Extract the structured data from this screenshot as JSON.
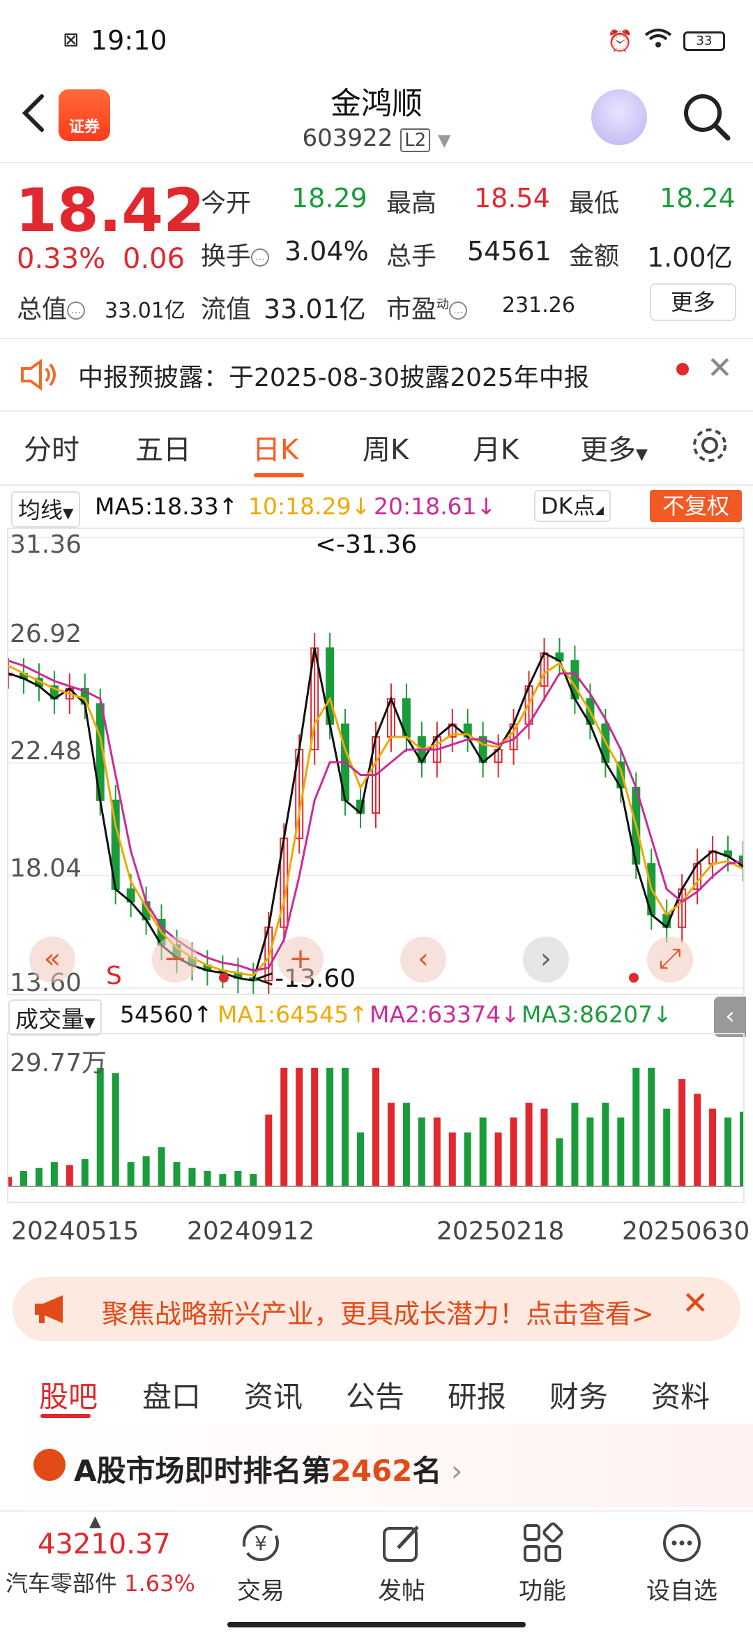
{
  "status": {
    "time": "19:10",
    "battery": "33"
  },
  "header": {
    "title": "金鸿顺",
    "code": "603922",
    "level": "L2",
    "logo_text": "证券"
  },
  "quote": {
    "price": "18.42",
    "change_pct": "0.33%",
    "change": "0.06",
    "rows": [
      [
        {
          "label": "今开",
          "value": "18.29"
        },
        {
          "label": "最高",
          "value": "18.54"
        },
        {
          "label": "最低",
          "value": "18.24"
        }
      ],
      [
        {
          "label": "换手",
          "value": "3.04%"
        },
        {
          "label": "总手",
          "value": "54561"
        },
        {
          "label": "金额",
          "value": "1.00亿"
        }
      ],
      [
        {
          "label": "流值",
          "value": "33.01亿"
        },
        {
          "label": "市盈",
          "value": "231.26"
        }
      ]
    ],
    "total_value_label": "总值",
    "total_value": "33.01亿",
    "pe_sup": "动",
    "more_label": "更多"
  },
  "notice": {
    "text": "中报预披露：于2025-08-30披露2025年中报"
  },
  "kline_tabs": [
    "分时",
    "五日",
    "日K",
    "周K",
    "月K",
    "更多"
  ],
  "active_tab": "日K",
  "ma": {
    "dropdown": "均线",
    "ma5": "MA5:18.33↑",
    "ma10": "10:18.29↓",
    "ma20": "20:18.61↓",
    "dk": "DK点",
    "fuquan": "不复权"
  },
  "colors": {
    "up": "#e0282e",
    "down": "#1a9c3a",
    "accent": "#ff5a1f",
    "ma5": "#111111",
    "ma10": "#f0a800",
    "ma20": "#cc2a9a"
  },
  "price_axis": {
    "labels": [
      "31.36",
      "26.92",
      "22.48",
      "18.04",
      "13.60"
    ],
    "max_label": "<-31.36",
    "min_label": "<-13.60"
  },
  "volume": {
    "dropdown": "成交量",
    "value": "54560↑",
    "ma1": "MA1:64545↑",
    "ma2": "MA2:63374↓",
    "ma3": "MA3:86207↓",
    "axis_max": "29.77万"
  },
  "dates": [
    "20240515",
    "20240912",
    "20250218",
    "20250630"
  ],
  "chart_controls": [
    "«",
    "−",
    "+",
    "‹",
    "›",
    "⤢"
  ],
  "s_marker": "S",
  "promo": {
    "text": "聚焦战略新兴产业，更具成长潜力！点击查看>"
  },
  "bottom_tabs": [
    "股吧",
    "盘口",
    "资讯",
    "公告",
    "研报",
    "财务",
    "资料"
  ],
  "rank": {
    "prefix": "A股市场即时排名第",
    "number": "2462",
    "suffix": "名"
  },
  "index": {
    "value": "43210.37",
    "name": "汽车零部件",
    "pct": "1.63%"
  },
  "nav": [
    {
      "label": "交易",
      "icon": "yen-exchange-icon"
    },
    {
      "label": "发帖",
      "icon": "edit-icon"
    },
    {
      "label": "功能",
      "icon": "grid-icon"
    },
    {
      "label": "设自选",
      "icon": "more-icon"
    }
  ],
  "chart_data": {
    "type": "candlestick",
    "ylim": [
      13.6,
      31.36
    ],
    "y_ticks": [
      31.36,
      26.92,
      22.48,
      18.04,
      13.6
    ],
    "x_ticks": [
      "20240515",
      "20240912",
      "20250218",
      "20250630"
    ],
    "series": [
      {
        "name": "MA5",
        "close_approx": [
          26.0,
          25.8,
          25.5,
          25.0,
          25.4,
          24.8,
          21.0,
          17.5,
          17.0,
          16.3,
          15.3,
          14.8,
          14.5,
          14.3,
          14.2,
          14.0,
          13.9,
          16.0,
          19.5,
          23.0,
          27.0,
          24.0,
          21.0,
          20.5,
          23.5,
          25.0,
          23.5,
          22.5,
          23.5,
          24.0,
          23.5,
          22.5,
          23.0,
          24.0,
          25.5,
          26.8,
          26.5,
          25.0,
          24.0,
          22.5,
          21.5,
          18.5,
          16.5,
          16.0,
          17.5,
          18.5,
          19.0,
          18.8,
          18.4
        ]
      },
      {
        "name": "MA10",
        "close_approx": [
          26.3,
          26.0,
          25.7,
          25.4,
          25.2,
          25.0,
          23.5,
          20.0,
          17.8,
          16.8,
          15.8,
          15.2,
          14.8,
          14.5,
          14.3,
          14.2,
          14.1,
          14.8,
          17.0,
          20.5,
          24.0,
          25.0,
          23.0,
          21.5,
          22.5,
          23.5,
          23.5,
          23.0,
          23.2,
          23.6,
          23.6,
          23.2,
          23.1,
          23.7,
          24.8,
          26.0,
          26.4,
          25.5,
          24.5,
          23.3,
          22.2,
          20.0,
          17.5,
          16.5,
          17.0,
          17.8,
          18.5,
          18.6,
          18.3
        ]
      },
      {
        "name": "MA20",
        "close_approx": [
          26.5,
          26.3,
          26.0,
          25.7,
          25.5,
          25.3,
          25.0,
          22.0,
          19.0,
          17.0,
          16.0,
          15.5,
          15.1,
          14.8,
          14.6,
          14.5,
          14.3,
          14.4,
          15.5,
          18.0,
          21.0,
          22.5,
          22.5,
          22.0,
          22.0,
          22.5,
          23.0,
          23.0,
          23.0,
          23.2,
          23.4,
          23.4,
          23.2,
          23.4,
          24.0,
          25.0,
          26.0,
          26.0,
          25.2,
          24.2,
          23.0,
          21.5,
          19.5,
          17.5,
          17.0,
          17.4,
          18.0,
          18.5,
          18.6
        ]
      }
    ],
    "volume_axis_max": "29.77万"
  }
}
